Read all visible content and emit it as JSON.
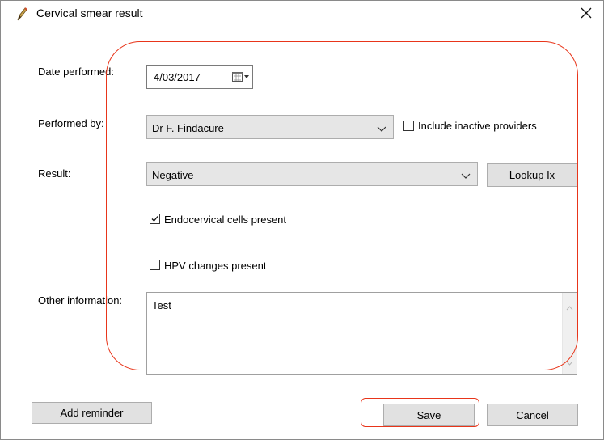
{
  "window": {
    "title": "Cervical smear result",
    "app_icon": "pen-icon",
    "close_icon": "close-icon"
  },
  "labels": {
    "date_performed": "Date performed:",
    "performed_by": "Performed by:",
    "result": "Result:",
    "other_information": "Other information:"
  },
  "date_performed": {
    "value": "4/03/2017",
    "icon": "calendar-dropdown-icon"
  },
  "performed_by": {
    "selected": "Dr F. Findacure",
    "icon": "chevron-down-icon"
  },
  "include_inactive": {
    "label": "Include inactive providers",
    "checked": false
  },
  "result": {
    "selected": "Negative",
    "icon": "chevron-down-icon"
  },
  "lookup_button": {
    "label": "Lookup Ix"
  },
  "endocervical": {
    "label": "Endocervical cells present",
    "checked": true
  },
  "hpv": {
    "label": "HPV changes present",
    "checked": false
  },
  "other_information": {
    "value": "Test"
  },
  "buttons": {
    "add_reminder": "Add reminder",
    "save": "Save",
    "cancel": "Cancel"
  },
  "annotation_color": "#e8351a"
}
